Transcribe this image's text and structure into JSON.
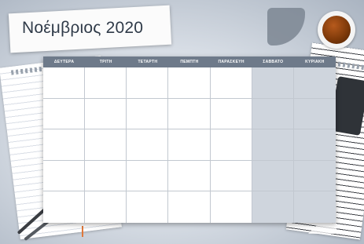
{
  "title": "Νοέμβριος 2020",
  "weekdays": [
    "ΔΕΥΤΕΡΑ",
    "ΤΡΙΤΗ",
    "ΤΕΤΑΡΤΗ",
    "ΠΕΜΠΤΗ",
    "ΠΑΡΑΣΚΕΥΗ",
    "ΣΑΒΒΑΤΟ",
    "ΚΥΡΙΑΚΗ"
  ],
  "weekend_color": "#cfd5dd",
  "header_color": "#6e7a8a"
}
